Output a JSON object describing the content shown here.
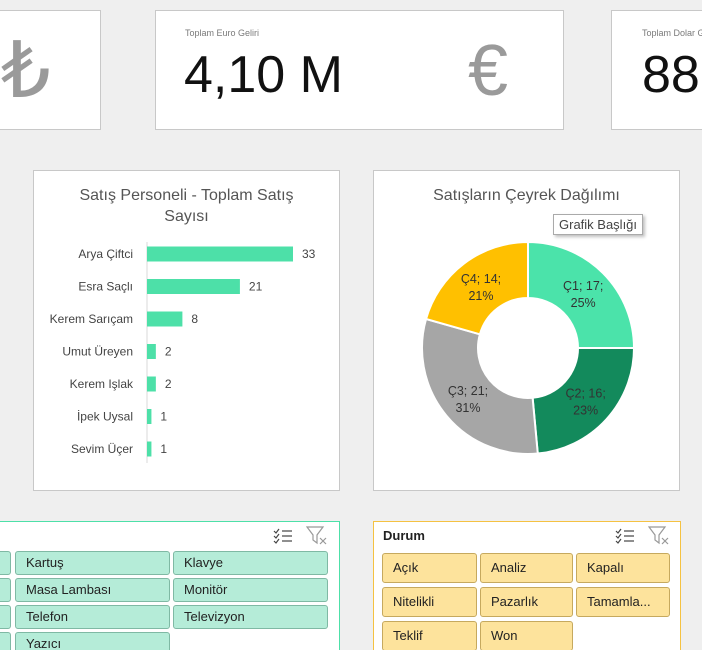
{
  "kpis": {
    "tl": {
      "symbol": "₺"
    },
    "euro": {
      "label": "Toplam Euro Geliri",
      "value": "4,10 M",
      "symbol": "€"
    },
    "dollar": {
      "label": "Toplam Dolar Geliri",
      "value": "88"
    }
  },
  "bar_chart": {
    "title_line1": "Satış Personeli - Toplam Satış",
    "title_line2": "Sayısı"
  },
  "donut_chart": {
    "title": "Satışların Çeyrek Dağılımı",
    "tooltip": "Grafik Başlığı"
  },
  "chart_data": [
    {
      "type": "bar",
      "title": "Satış Personeli - Toplam Satış Sayısı",
      "orientation": "horizontal",
      "categories": [
        "Arya Çiftci",
        "Esra Saçlı",
        "Kerem Sarıçam",
        "Umut Üreyen",
        "Kerem Işlak",
        "İpek Uysal",
        "Sevim Üçer"
      ],
      "values": [
        33,
        21,
        8,
        2,
        2,
        1,
        1
      ],
      "color": "#4de0a8",
      "data_labels": true
    },
    {
      "type": "pie",
      "donut": true,
      "title": "Satışların Çeyrek Dağılımı",
      "slices": [
        {
          "label": "Ç1; 17; 25%",
          "name": "Ç1",
          "value": 17,
          "percent": 25,
          "color": "#4be3aa"
        },
        {
          "label": "Ç2; 16; 23%",
          "name": "Ç2",
          "value": 16,
          "percent": 23,
          "color": "#138a5c"
        },
        {
          "label": "Ç3; 21; 31%",
          "name": "Ç3",
          "value": 21,
          "percent": 31,
          "color": "#a6a6a6"
        },
        {
          "label": "Ç4; 14; 21%",
          "name": "Ç4",
          "value": 14,
          "percent": 21,
          "color": "#ffc000"
        }
      ]
    }
  ],
  "urun_slicer": {
    "items": [
      "Kartuş",
      "Klavye",
      "Masa Lambası",
      "Monitör",
      "Telefon",
      "Televizyon",
      "Yazıcı"
    ]
  },
  "durum_slicer": {
    "title": "Durum",
    "items": [
      "Açık",
      "Analiz",
      "Kapalı",
      "Nitelikli",
      "Pazarlık",
      "Tamamla...",
      "Teklif",
      "Won"
    ]
  },
  "colors": {
    "green_slicer_border": "#4de0a8",
    "yellow_slicer_border": "#f5c242",
    "bar": "#4de0a8"
  }
}
